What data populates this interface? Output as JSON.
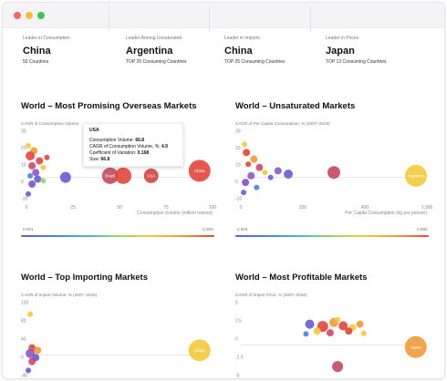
{
  "window": {
    "controls": [
      "close",
      "minimize",
      "maximize"
    ]
  },
  "stats": [
    {
      "label": "Leader in Consumption",
      "value": "China",
      "sub": "50 Countries"
    },
    {
      "label": "Leader Among Unsaturated",
      "value": "Argentina",
      "sub": "TOP 25 Consuming Countries"
    },
    {
      "label": "Leader in Imports",
      "value": "China",
      "sub": "TOP 25 Consuming Countries"
    },
    {
      "label": "Leader in Prices",
      "value": "Japan",
      "sub": "TOP 13 Consuming Countries"
    }
  ],
  "tooltip": {
    "country": "USA",
    "rows": [
      {
        "k": "Consumption Volume:",
        "v": "66.8"
      },
      {
        "k": "CAGR of Consumption Volume, %:",
        "v": "4.9"
      },
      {
        "k": "Coefficient of Variation:",
        "v": "0.168"
      },
      {
        "k": "Size:",
        "v": "66.8"
      }
    ]
  },
  "colors": {
    "accent_red": "#e2463d",
    "accent_yellow": "#f3c93c",
    "accent_purple": "#6a5bd1"
  },
  "chart_data": [
    {
      "type": "scatter",
      "title": "World – Most Promising Overseas Markets",
      "ylabel": "CAGR of Consumption Volume",
      "xlabel": "Consumption Volume (million tonnes)",
      "xlim": [
        0,
        100
      ],
      "ylim": [
        -15,
        30
      ],
      "yticks": [
        "30",
        "20",
        "10",
        "0",
        "-10"
      ],
      "xticks": [
        "0",
        "25",
        "50",
        "75",
        "100"
      ],
      "legend_scale": [
        "0.001",
        "0.093"
      ],
      "points": [
        {
          "label": "China",
          "x": 93,
          "y": 4,
          "r": 12,
          "color": "#e2463d"
        },
        {
          "label": "Brazil",
          "x": 45,
          "y": 1,
          "r": 9,
          "color": "#c24a5e"
        },
        {
          "label": "",
          "x": 52,
          "y": 1,
          "r": 9,
          "color": "#e2463d"
        },
        {
          "label": "USA",
          "x": 67,
          "y": 1,
          "r": 8,
          "color": "#d2453f"
        },
        {
          "label": "",
          "x": 21,
          "y": 0,
          "r": 6,
          "color": "#6a5bd1"
        },
        {
          "label": "",
          "x": 1,
          "y": 19,
          "r": 3,
          "color": "#f3c93c"
        },
        {
          "label": "",
          "x": 4,
          "y": 16,
          "r": 4,
          "color": "#f19a3a"
        },
        {
          "label": "",
          "x": 2,
          "y": 13,
          "r": 5,
          "color": "#e2463d"
        },
        {
          "label": "",
          "x": 7,
          "y": 10,
          "r": 4,
          "color": "#e2463d"
        },
        {
          "label": "",
          "x": 3,
          "y": 7,
          "r": 4,
          "color": "#d1466b"
        },
        {
          "label": "",
          "x": 9,
          "y": 6,
          "r": 3,
          "color": "#f3c93c"
        },
        {
          "label": "",
          "x": 5,
          "y": 3,
          "r": 4,
          "color": "#8e5bc3"
        },
        {
          "label": "",
          "x": 2,
          "y": 1,
          "r": 3,
          "color": "#4f7ee0"
        },
        {
          "label": "",
          "x": 6,
          "y": -1,
          "r": 4,
          "color": "#6a5bd1"
        },
        {
          "label": "",
          "x": 3,
          "y": -4,
          "r": 4,
          "color": "#7a53c9"
        },
        {
          "label": "",
          "x": 9,
          "y": -2,
          "r": 3,
          "color": "#9bd46a"
        },
        {
          "label": "",
          "x": 1,
          "y": -10,
          "r": 3,
          "color": "#6a5bd1"
        },
        {
          "label": "",
          "x": 11,
          "y": 12,
          "r": 3,
          "color": "#e2463d"
        }
      ]
    },
    {
      "type": "scatter",
      "title": "World – Unsaturated Markets",
      "ylabel": "CAGR of Per Capita Consumption, % (2007–2016)",
      "xlabel": "Per Capita Consumption (kg per person)",
      "xlim": [
        0,
        1000
      ],
      "ylim": [
        -15,
        30
      ],
      "yticks": [
        "30",
        "20",
        "10",
        "0",
        "-10"
      ],
      "xticks": [
        "0",
        "200",
        "400",
        "1,000"
      ],
      "legend_scale": [
        "0.004",
        "0.090"
      ],
      "points": [
        {
          "label": "Argentina",
          "x": 955,
          "y": 1,
          "r": 12,
          "color": "#f3c93c"
        },
        {
          "label": "",
          "x": 500,
          "y": 3,
          "r": 7,
          "color": "#c24a5e"
        },
        {
          "label": "",
          "x": 255,
          "y": 2,
          "r": 5,
          "color": "#6a5bd1"
        },
        {
          "label": "",
          "x": 200,
          "y": 4,
          "r": 4,
          "color": "#8e5bc3"
        },
        {
          "label": "",
          "x": 20,
          "y": 20,
          "r": 3,
          "color": "#f3c93c"
        },
        {
          "label": "",
          "x": 30,
          "y": 15,
          "r": 4,
          "color": "#e2463d"
        },
        {
          "label": "",
          "x": 70,
          "y": 11,
          "r": 4,
          "color": "#f19a3a"
        },
        {
          "label": "",
          "x": 40,
          "y": 8,
          "r": 3,
          "color": "#e2463d"
        },
        {
          "label": "",
          "x": 100,
          "y": 6,
          "r": 4,
          "color": "#d1466b"
        },
        {
          "label": "",
          "x": 130,
          "y": 3,
          "r": 3,
          "color": "#f3c93c"
        },
        {
          "label": "",
          "x": 55,
          "y": 1,
          "r": 4,
          "color": "#8e5bc3"
        },
        {
          "label": "",
          "x": 160,
          "y": 0,
          "r": 3,
          "color": "#6a5bd1"
        },
        {
          "label": "",
          "x": 25,
          "y": -3,
          "r": 4,
          "color": "#7a53c9"
        },
        {
          "label": "",
          "x": 85,
          "y": -6,
          "r": 3,
          "color": "#4f7ee0"
        },
        {
          "label": "",
          "x": 15,
          "y": -9,
          "r": 3,
          "color": "#6a5bd1"
        }
      ]
    },
    {
      "type": "scatter",
      "title": "World – Top Importing Markets",
      "ylabel": "CAGR of Import Volume, % (2007–2016)",
      "xlabel": "",
      "xlim": [
        0,
        100
      ],
      "ylim": [
        -60,
        140
      ],
      "yticks": [
        "120",
        "80",
        "40",
        "0",
        "-40"
      ],
      "xticks": [],
      "legend_scale": [],
      "points": [
        {
          "label": "China",
          "x": 93,
          "y": 12,
          "r": 12,
          "color": "#f3c93c"
        },
        {
          "label": "",
          "x": 2,
          "y": 102,
          "r": 3,
          "color": "#f3c93c"
        },
        {
          "label": "",
          "x": 3,
          "y": 18,
          "r": 4,
          "color": "#e2463d"
        },
        {
          "label": "",
          "x": 6,
          "y": 12,
          "r": 4,
          "color": "#f19a3a"
        },
        {
          "label": "",
          "x": 2,
          "y": 4,
          "r": 5,
          "color": "#8e5bc3"
        },
        {
          "label": "",
          "x": 5,
          "y": -6,
          "r": 4,
          "color": "#6a5bd1"
        },
        {
          "label": "",
          "x": 3,
          "y": -16,
          "r": 4,
          "color": "#d1466b"
        },
        {
          "label": "",
          "x": 1,
          "y": -38,
          "r": 3,
          "color": "#6a5bd1"
        }
      ]
    },
    {
      "type": "scatter",
      "title": "World – Most Profitable Markets",
      "ylabel": "CAGR of Import Price, % (2007–2016)",
      "xlabel": "",
      "xlim": [
        0,
        100
      ],
      "ylim": [
        -6,
        8
      ],
      "yticks": [
        "5",
        "2.5",
        "0",
        "-2.5",
        "-5"
      ],
      "xticks": [],
      "legend_scale": [],
      "points": [
        {
          "label": "Japan",
          "x": 94,
          "y": -0.4,
          "r": 12,
          "color": "#f19a3a"
        },
        {
          "label": "",
          "x": 52,
          "y": -3.8,
          "r": 6,
          "color": "#c24a5e"
        },
        {
          "label": "",
          "x": 37,
          "y": 3.6,
          "r": 5,
          "color": "#6a5bd1"
        },
        {
          "label": "",
          "x": 44,
          "y": 3.2,
          "r": 6,
          "color": "#e2463d"
        },
        {
          "label": "",
          "x": 50,
          "y": 3.9,
          "r": 5,
          "color": "#f19a3a"
        },
        {
          "label": "",
          "x": 55,
          "y": 3.3,
          "r": 5,
          "color": "#e2463d"
        },
        {
          "label": "",
          "x": 60,
          "y": 3.0,
          "r": 4,
          "color": "#f3c93c"
        },
        {
          "label": "",
          "x": 64,
          "y": 3.6,
          "r": 4,
          "color": "#f19a3a"
        },
        {
          "label": "",
          "x": 41,
          "y": 2.4,
          "r": 4,
          "color": "#f3c93c"
        },
        {
          "label": "",
          "x": 48,
          "y": 2.1,
          "r": 4,
          "color": "#d1466b"
        },
        {
          "label": "",
          "x": 58,
          "y": 2.4,
          "r": 4,
          "color": "#e2463d"
        },
        {
          "label": "",
          "x": 35,
          "y": 1.9,
          "r": 3,
          "color": "#4f7ee0"
        },
        {
          "label": "",
          "x": 66,
          "y": 2.0,
          "r": 3,
          "color": "#f3c93c"
        },
        {
          "label": "",
          "x": 52,
          "y": 4.4,
          "r": 3,
          "color": "#f3c93c"
        }
      ]
    }
  ]
}
